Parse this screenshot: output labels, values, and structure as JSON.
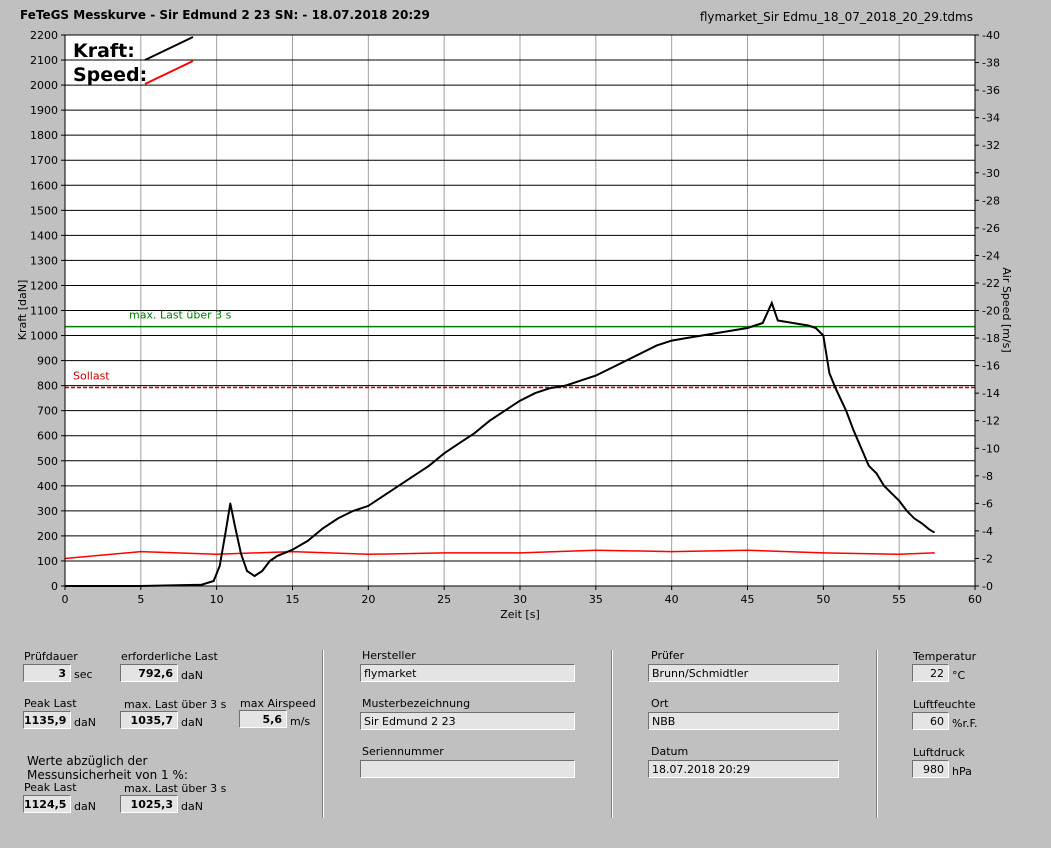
{
  "header": {
    "title": "FeTeGS Messkurve - Sir Edmund 2 23  SN:  - 18.07.2018 20:29",
    "filename": "flymarket_Sir Edmu_18_07_2018_20_29.tdms"
  },
  "colors": {
    "background": "#c0c0c0",
    "plot_background": "#ffffff",
    "kraft": "#000000",
    "speed": "#ff0000",
    "max_last_line": "#008000",
    "sollast_line": "#cc0000"
  },
  "chart_data": {
    "type": "line",
    "xlabel": "Zeit [s]",
    "ylabel": "Kraft [daN]",
    "y2label": "Air Speed [m/s]",
    "xlim": [
      0,
      60
    ],
    "ylim": [
      0,
      2200
    ],
    "y2lim": [
      0,
      40
    ],
    "x_ticks": [
      0,
      5,
      10,
      15,
      20,
      25,
      30,
      35,
      40,
      45,
      50,
      55,
      60
    ],
    "y_ticks": [
      0,
      100,
      200,
      300,
      400,
      500,
      600,
      700,
      800,
      900,
      1000,
      1100,
      1200,
      1300,
      1400,
      1500,
      1600,
      1700,
      1800,
      1900,
      2000,
      2100,
      2200
    ],
    "y2_ticks": [
      0,
      2,
      4,
      6,
      8,
      10,
      12,
      14,
      16,
      18,
      20,
      22,
      24,
      26,
      28,
      30,
      32,
      34,
      36,
      38,
      40
    ],
    "grid": "horizontal + vertical",
    "legend": [
      {
        "name": "Kraft:",
        "color": "#000000"
      },
      {
        "name": "Speed:",
        "color": "#ff0000"
      }
    ],
    "reference_lines": [
      {
        "label": "max. Last über  3 s",
        "y": 1035.7,
        "color": "#008000",
        "style": "solid"
      },
      {
        "label": "Sollast",
        "y": 792.6,
        "color": "#cc0000",
        "style": "dashed"
      }
    ],
    "series": [
      {
        "name": "Kraft:",
        "axis": "left",
        "color": "#000000",
        "x": [
          0,
          5,
          9,
          9.8,
          10.2,
          10.6,
          10.9,
          11.2,
          11.6,
          12.0,
          12.5,
          13.0,
          13.5,
          14.0,
          15.0,
          16.0,
          17.0,
          18.0,
          19.0,
          20.0,
          21.0,
          22.0,
          23.0,
          24.0,
          25.0,
          26.0,
          27.0,
          28.0,
          29.0,
          30.0,
          31.0,
          32.0,
          33.0,
          34.0,
          35.0,
          36.0,
          37.0,
          38.0,
          39.0,
          40.0,
          41.0,
          42.0,
          43.0,
          44.0,
          45.0,
          46.0,
          46.6,
          47.0,
          48.0,
          49.0,
          49.5,
          50.0,
          50.4,
          50.8,
          51.5,
          52.0,
          52.5,
          53.0,
          53.5,
          54.0,
          54.5,
          55.0,
          55.5,
          56.0,
          56.5,
          57.0,
          57.3
        ],
        "y": [
          0,
          0,
          5,
          20,
          80,
          220,
          330,
          240,
          130,
          60,
          40,
          60,
          100,
          120,
          145,
          180,
          230,
          270,
          300,
          320,
          360,
          400,
          440,
          480,
          530,
          570,
          610,
          660,
          700,
          740,
          770,
          790,
          800,
          820,
          840,
          870,
          900,
          930,
          960,
          980,
          990,
          1000,
          1010,
          1020,
          1030,
          1050,
          1130,
          1060,
          1050,
          1040,
          1030,
          1000,
          850,
          790,
          700,
          620,
          550,
          480,
          450,
          400,
          370,
          340,
          300,
          270,
          250,
          225,
          215
        ]
      },
      {
        "name": "Speed:",
        "axis": "right",
        "color": "#ff0000",
        "x": [
          0,
          5,
          10,
          15,
          20,
          25,
          30,
          35,
          40,
          45,
          50,
          55,
          57.3
        ],
        "y": [
          2.0,
          2.5,
          2.3,
          2.5,
          2.3,
          2.4,
          2.4,
          2.6,
          2.5,
          2.6,
          2.4,
          2.3,
          2.4
        ]
      }
    ]
  },
  "panel": {
    "pruefdauer_label": "Prüfdauer",
    "pruefdauer_value": "3",
    "pruefdauer_unit": "sec",
    "erf_last_label": "erforderliche Last",
    "erf_last_value": "792,6",
    "erf_last_unit": "daN",
    "peak_last_label": "Peak Last",
    "peak_last_value": "1135,9",
    "peak_last_unit": "daN",
    "max_last_label": "max. Last über  3 s",
    "max_last_value": "1035,7",
    "max_last_unit": "daN",
    "max_airspeed_label": "max Airspeed",
    "max_airspeed_value": "5,6",
    "max_airspeed_unit": "m/s",
    "werte_line1": "Werte abzüglich der",
    "werte_line2": "Messunsicherheit von 1  %:",
    "peak_last2_label": "Peak Last",
    "peak_last2_value": "1124,5",
    "peak_last2_unit": "daN",
    "max_last2_label": "max. Last über  3 s",
    "max_last2_value": "1025,3",
    "max_last2_unit": "daN",
    "hersteller_label": "Hersteller",
    "hersteller_value": "flymarket",
    "muster_label": "Musterbezeichnung",
    "muster_value": "Sir Edmund 2 23",
    "serien_label": "Seriennummer",
    "serien_value": "",
    "pruefer_label": "Prüfer",
    "pruefer_value": "Brunn/Schmidtler",
    "ort_label": "Ort",
    "ort_value": "NBB",
    "datum_label": "Datum",
    "datum_value": "18.07.2018 20:29",
    "temp_label": "Temperatur",
    "temp_value": "22",
    "temp_unit": "°C",
    "feuchte_label": "Luftfeuchte",
    "feuchte_value": "60",
    "feuchte_unit": "%r.F.",
    "druck_label": "Luftdruck",
    "druck_value": "980",
    "druck_unit": "hPa"
  }
}
